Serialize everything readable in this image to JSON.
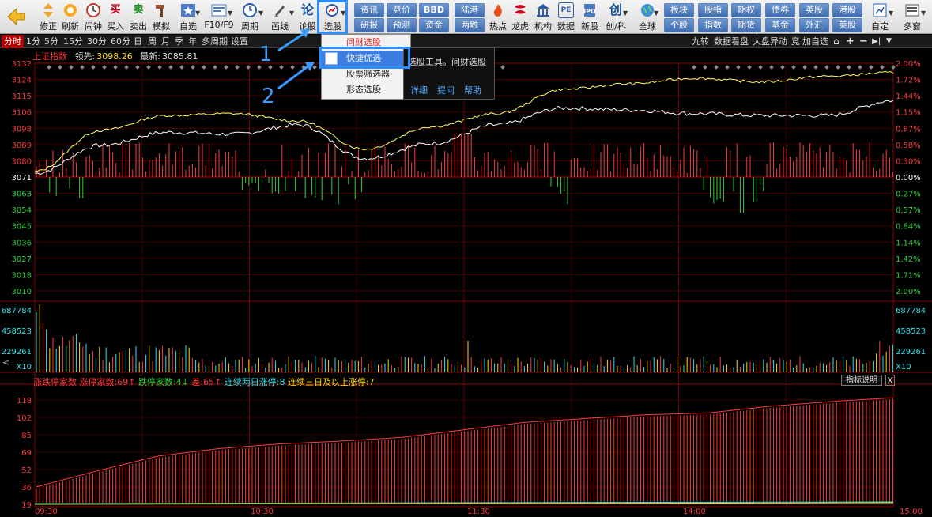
{
  "toolbar": {
    "buttons": [
      {
        "label": "",
        "icon": "back-arrow-icon"
      },
      {
        "label": "修正",
        "icon": "up-down-arrow-icon"
      },
      {
        "label": "刷新",
        "icon": "refresh-icon"
      },
      {
        "label": "闹钟",
        "icon": "clock-icon"
      },
      {
        "label": "买入",
        "icon": "buy-icon",
        "glyph": "买"
      },
      {
        "label": "卖出",
        "icon": "sell-icon",
        "glyph": "卖"
      },
      {
        "label": "模拟",
        "icon": "hammer-icon"
      },
      {
        "label": "自选",
        "icon": "star-icon"
      },
      {
        "label": "F10/F9",
        "icon": "f10-icon"
      },
      {
        "label": "周期",
        "icon": "period-icon"
      },
      {
        "label": "画线",
        "icon": "pen-icon"
      },
      {
        "label": "论股",
        "icon": "discuss-icon",
        "glyph": "论"
      },
      {
        "label": "选股",
        "icon": "stock-picker-icon"
      },
      {
        "label": "热点",
        "icon": "hot-icon"
      },
      {
        "label": "龙虎",
        "icon": "dragon-tiger-icon"
      },
      {
        "label": "机构",
        "icon": "institution-icon"
      },
      {
        "label": "数据",
        "icon": "data-pe-icon",
        "glyph": "PE"
      },
      {
        "label": "新股",
        "icon": "new-stock-icon"
      },
      {
        "label": "创/科",
        "icon": "chinext-icon",
        "glyph": "创"
      },
      {
        "label": "全球",
        "icon": "globe-icon"
      },
      {
        "label": "自定",
        "icon": "custom-icon"
      },
      {
        "label": "多窗",
        "icon": "multi-window-icon"
      }
    ],
    "mini_buttons": [
      {
        "label": "资讯"
      },
      {
        "label": "竞价"
      },
      {
        "label": "BBD"
      },
      {
        "label": "陆港"
      },
      {
        "label": "研报"
      },
      {
        "label": "预测"
      },
      {
        "label": "资金"
      },
      {
        "label": "两融"
      },
      {
        "label": "板块"
      },
      {
        "label": "股指"
      },
      {
        "label": "期权"
      },
      {
        "label": "债券"
      },
      {
        "label": "英股"
      },
      {
        "label": "港股"
      },
      {
        "label": "个股"
      },
      {
        "label": "指数"
      },
      {
        "label": "期货"
      },
      {
        "label": "基金"
      },
      {
        "label": "外汇"
      },
      {
        "label": "美股"
      }
    ]
  },
  "tabs": [
    "分时",
    "1分",
    "5分",
    "15分",
    "30分",
    "60分",
    "日",
    "周",
    "月",
    "季",
    "年",
    "多周期",
    "设置"
  ],
  "right_tabs": [
    "九转",
    "数据看盘",
    "大盘异动",
    "竞",
    "加自选"
  ],
  "index": {
    "name": "上证指数",
    "lead_label": "领先:",
    "lead_value": "3098.26",
    "latest_label": "最新:",
    "latest_value": "3085.81"
  },
  "price_axis": {
    "left": [
      "3132",
      "3124",
      "3115",
      "3106",
      "3098",
      "3089",
      "3080",
      "3071",
      "3063",
      "3054",
      "3045",
      "3036",
      "3027",
      "3018",
      "3010"
    ],
    "right": [
      "2.00%",
      "1.72%",
      "1.44%",
      "1.15%",
      "0.87%",
      "0.58%",
      "0.30%",
      "0.00%",
      "0.27%",
      "0.57%",
      "0.84%",
      "1.14%",
      "1.42%",
      "1.71%",
      "2.00%"
    ]
  },
  "volume_axis": {
    "left": [
      "687784",
      "458523",
      "229261",
      "X10"
    ],
    "right": [
      "687784",
      "458523",
      "229261",
      "X10"
    ]
  },
  "breadth": {
    "title": "涨跌停家数",
    "up_label": "涨停家数:",
    "up_value": "69↑",
    "down_label": "跌停家数:",
    "down_value": "4↓",
    "diff_label": "差:",
    "diff_value": "65↑",
    "two_label": "连续两日涨停:",
    "two_value": "8",
    "three_label": "连续三日及以上涨停:",
    "three_value": "7",
    "indicator_button": "指标说明",
    "close": "X",
    "axis": [
      "118",
      "102",
      "85",
      "69",
      "52",
      "36",
      "19"
    ]
  },
  "time_axis": [
    "09:30",
    "10:30",
    "11:30",
    "14:00",
    "15:00"
  ],
  "dropdown": {
    "items": [
      "问财选股",
      "快捷优选",
      "股票筛选器",
      "形态选股"
    ],
    "highlighted_index": 1
  },
  "tooltip": {
    "desc": "选股工具。问财选股",
    "links": [
      "详细",
      "提问",
      "帮助"
    ]
  },
  "callouts": [
    "1",
    "2"
  ],
  "colors": {
    "up": "#ff3b3b",
    "down": "#2fd03a",
    "price_line": "#ffffff",
    "avg_line": "#ffff66",
    "highlight": "#2b8fff"
  },
  "chart_data": {
    "type": "line",
    "title": "上证指数",
    "x": [
      "09:30",
      "10:30",
      "11:30",
      "14:00",
      "15:00"
    ],
    "ylim": [
      3010,
      3132
    ],
    "series": [
      {
        "values": [
          3073,
          3088,
          3095,
          3094,
          3099,
          3081,
          3089,
          3099,
          3108,
          3107,
          3105,
          3104,
          3104,
          3112
        ]
      },
      {
        "values": [
          3074,
          3096,
          3104,
          3105,
          3101,
          3086,
          3098,
          3105,
          3118,
          3121,
          3124,
          3122,
          3125,
          3127
        ]
      }
    ],
    "breadth_ylim": [
      0,
      120
    ],
    "breadth_values": [
      19,
      36,
      52,
      60,
      65,
      68,
      72,
      80,
      88,
      92,
      96,
      98,
      105,
      110,
      114
    ]
  }
}
